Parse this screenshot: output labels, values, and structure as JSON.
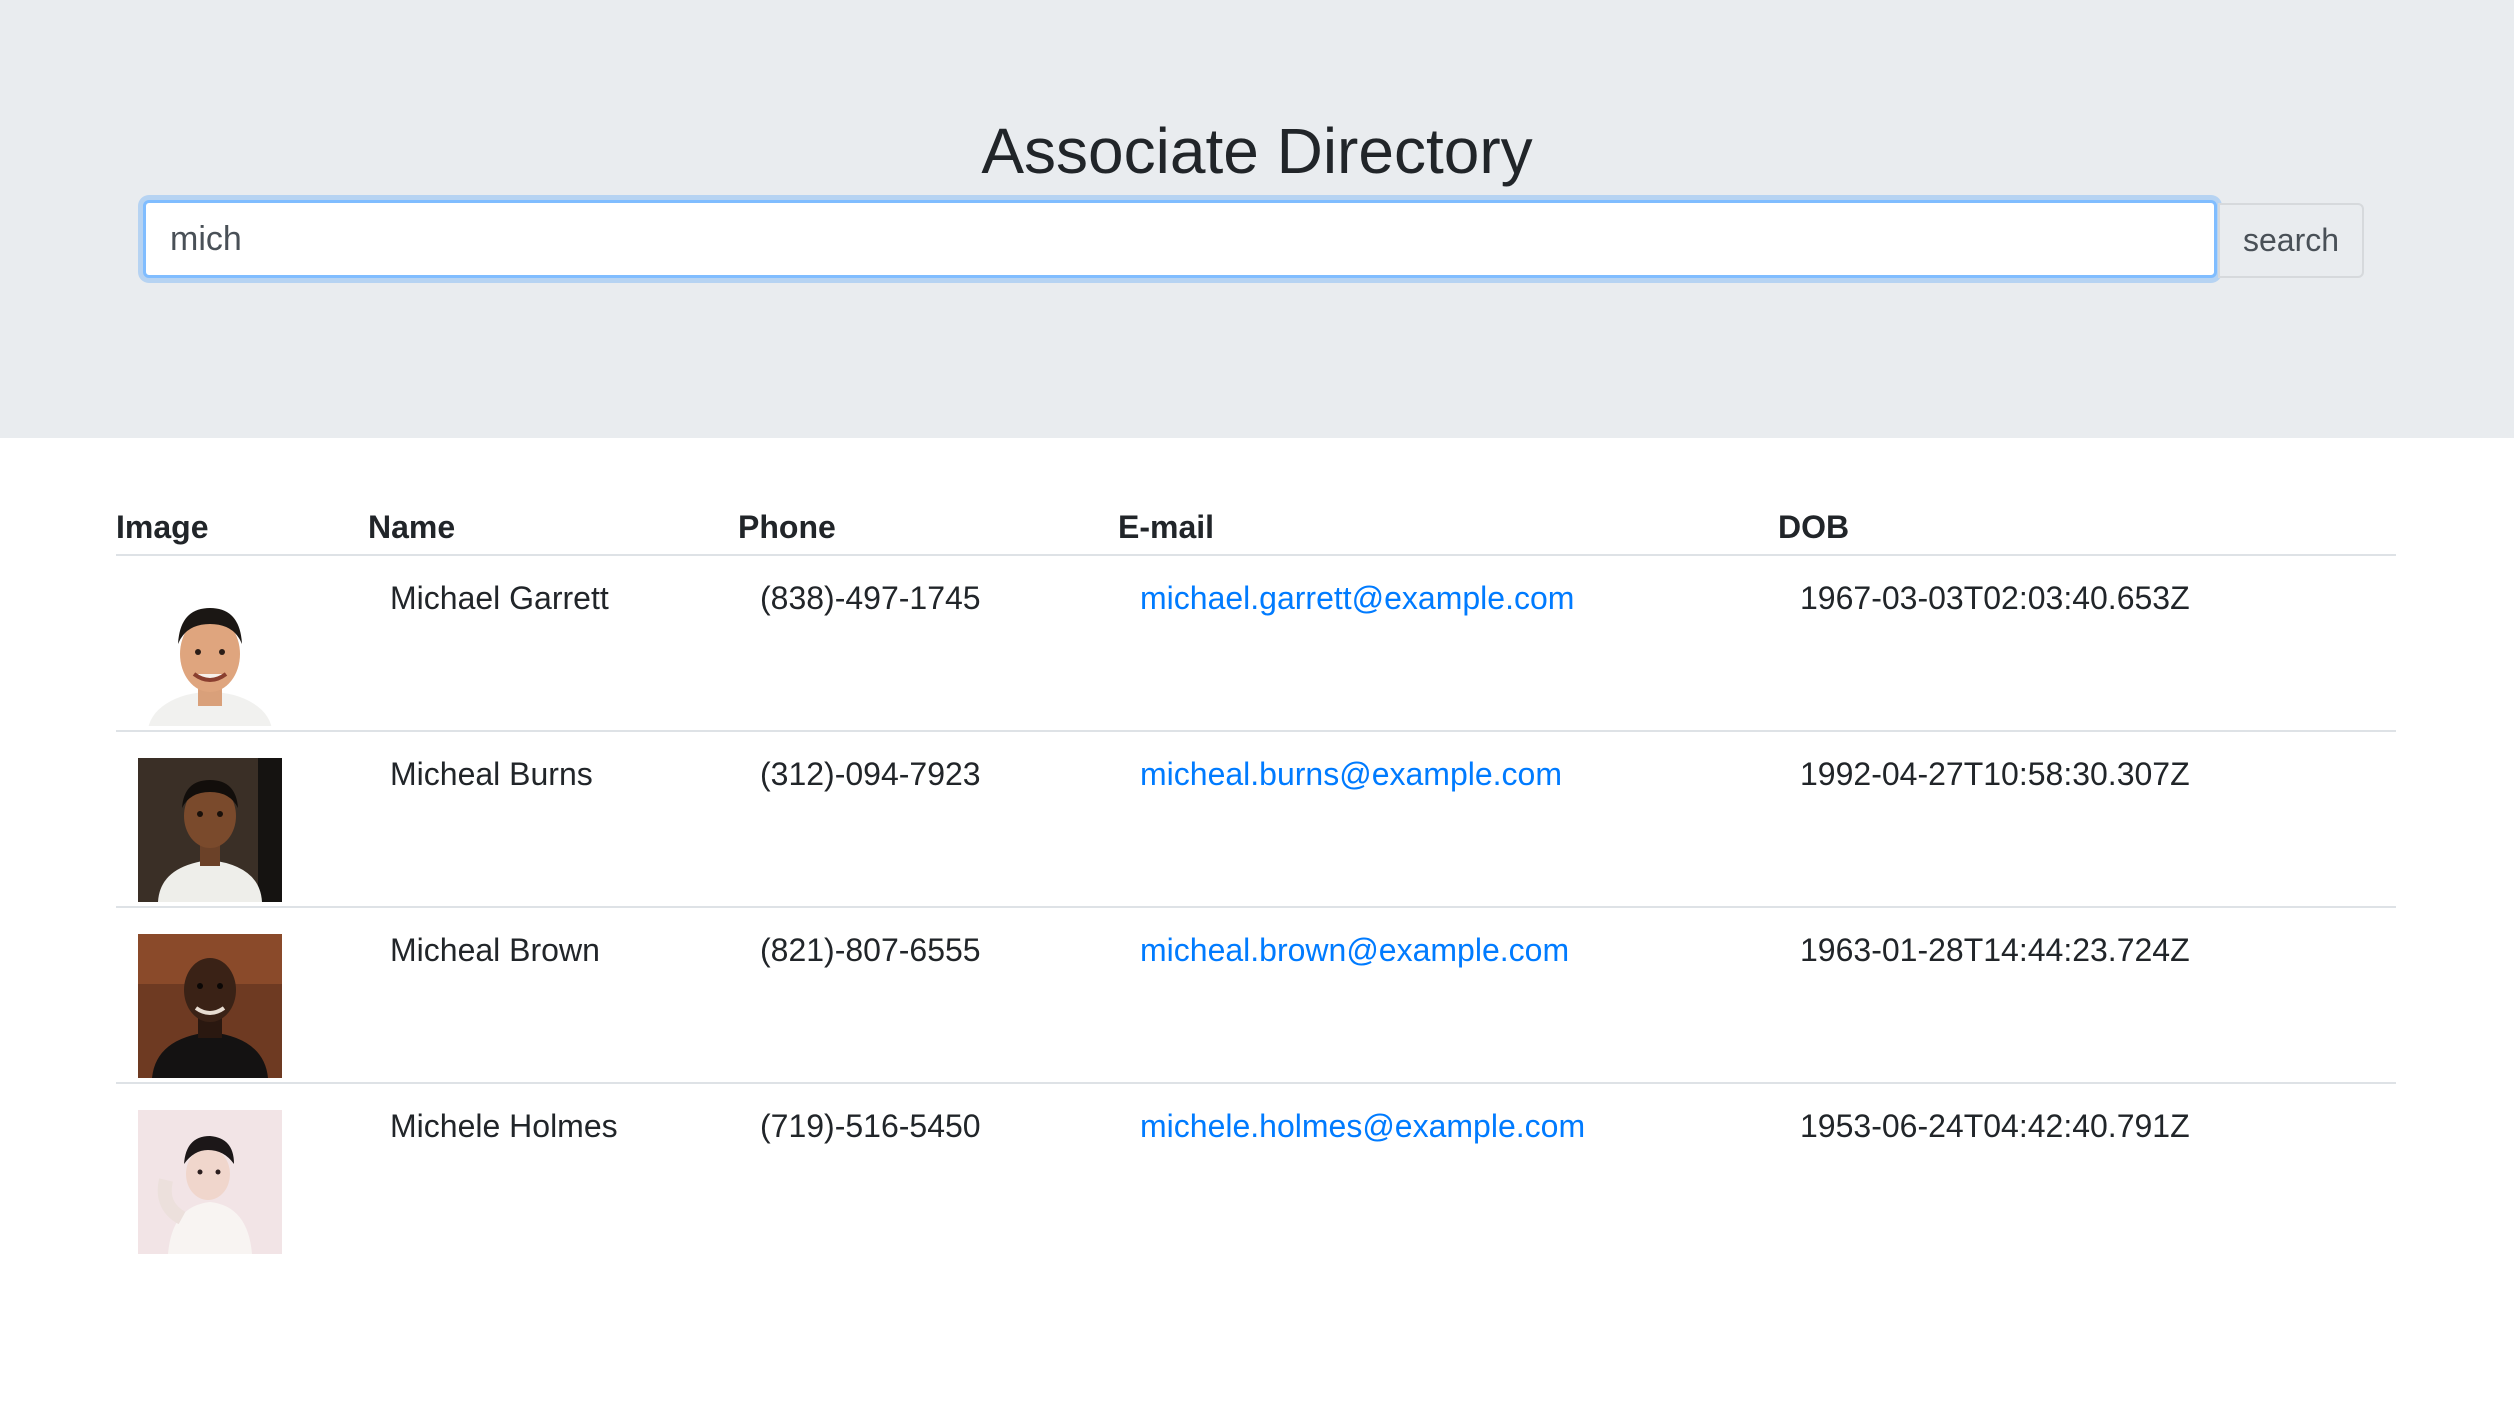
{
  "header": {
    "title": "Associate Directory"
  },
  "search": {
    "value": "mich",
    "button_label": "search"
  },
  "table": {
    "columns": [
      "Image",
      "Name",
      "Phone",
      "E-mail",
      "DOB"
    ],
    "rows": [
      {
        "name": "Michael Garrett",
        "phone": "(838)-497-1745",
        "email": "michael.garrett@example.com",
        "dob": "1967-03-03T02:03:40.653Z"
      },
      {
        "name": "Micheal Burns",
        "phone": "(312)-094-7923",
        "email": "micheal.burns@example.com",
        "dob": "1992-04-27T10:58:30.307Z"
      },
      {
        "name": "Micheal Brown",
        "phone": "(821)-807-6555",
        "email": "micheal.brown@example.com",
        "dob": "1963-01-28T14:44:23.724Z"
      },
      {
        "name": "Michele Holmes",
        "phone": "(719)-516-5450",
        "email": "michele.holmes@example.com",
        "dob": "1953-06-24T04:42:40.791Z"
      }
    ]
  },
  "colors": {
    "link": "#007bff",
    "jumbotron_bg": "#e9ecef",
    "focus_border": "#80bdff"
  }
}
